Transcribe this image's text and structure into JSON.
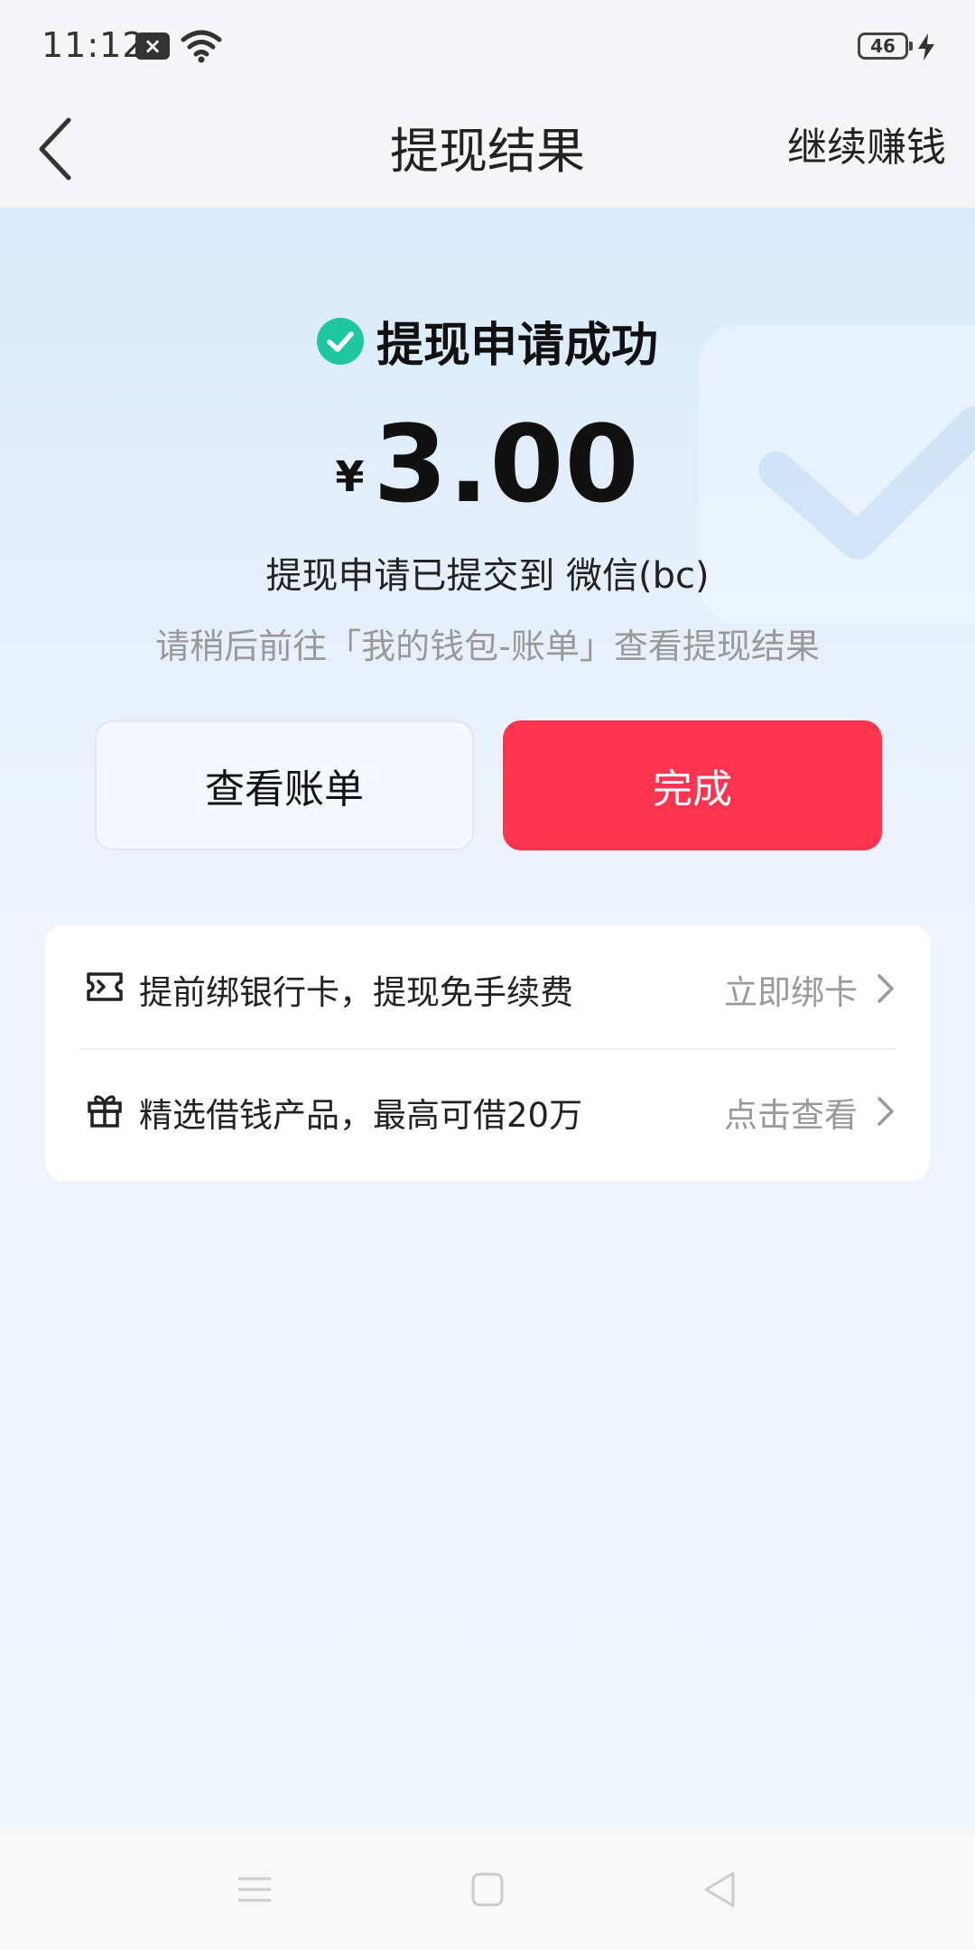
{
  "status_bar": {
    "time": "11:12",
    "battery": "46",
    "icons": [
      "notification-x-icon",
      "wifi-icon",
      "battery-icon",
      "charging-bolt-icon"
    ]
  },
  "nav": {
    "title": "提现结果",
    "action": "继续赚钱",
    "back_icon": "chevron-left-icon"
  },
  "result": {
    "status": "提现申请成功",
    "currency": "¥",
    "amount": "3.00",
    "submitted_text": "提现申请已提交到 微信(bc)",
    "hint": "请稍后前往「我的钱包-账单」查看提现结果"
  },
  "buttons": {
    "view_bill": "查看账单",
    "done": "完成"
  },
  "promo": {
    "items": [
      {
        "icon": "ticket-icon",
        "text": "提前绑银行卡，提现免手续费",
        "action": "立即绑卡"
      },
      {
        "icon": "gift-icon",
        "text": "精选借钱产品，最高可借20万",
        "action": "点击查看"
      }
    ]
  },
  "colors": {
    "primary_red": "#fd344f",
    "success_green": "#1ec7a0",
    "hint_gray": "#999999"
  },
  "system_nav": {
    "icons": [
      "menu-icon",
      "home-square-icon",
      "back-triangle-icon"
    ]
  }
}
